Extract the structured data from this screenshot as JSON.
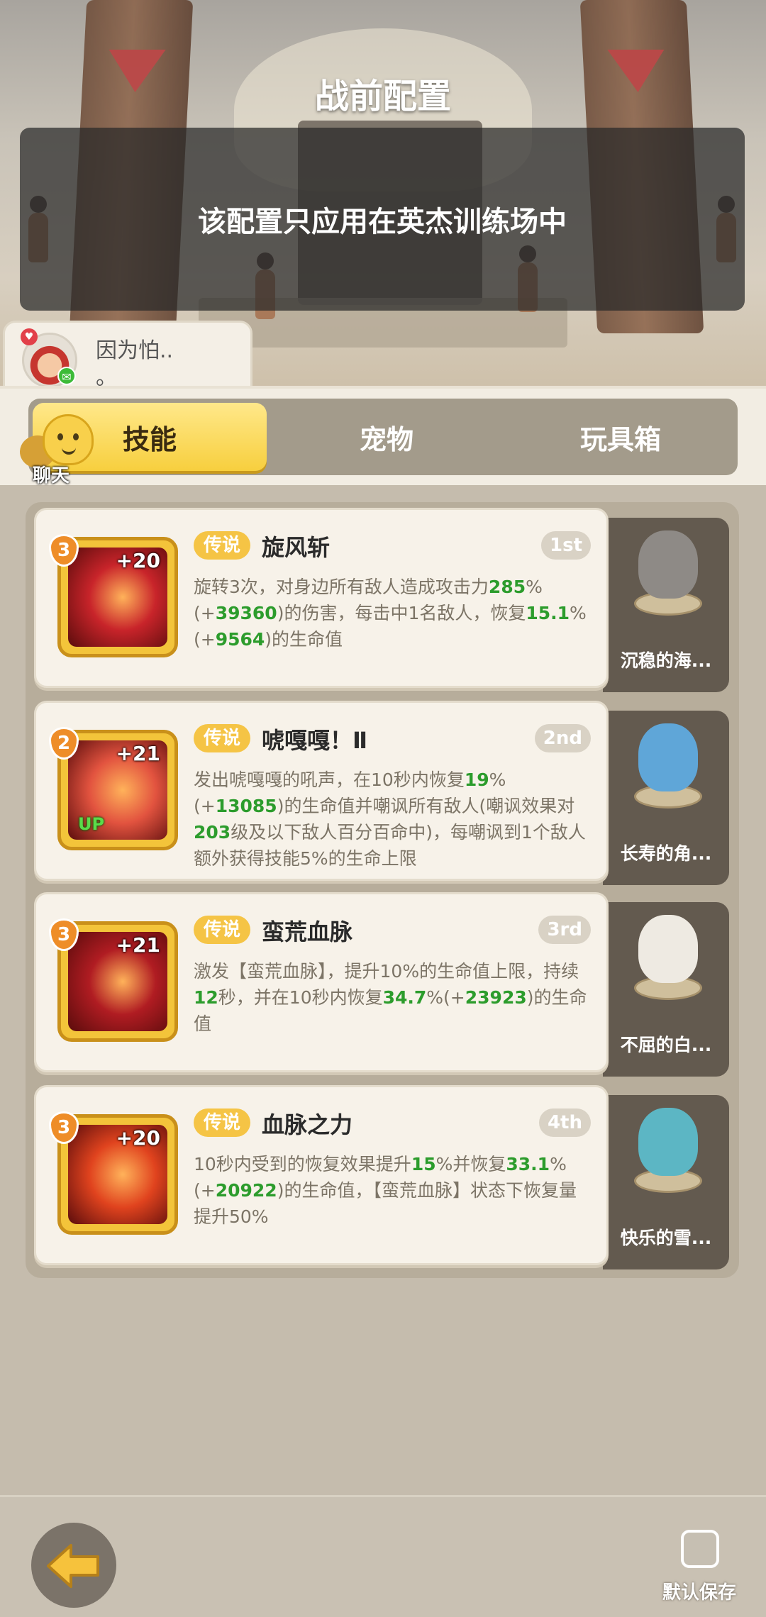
{
  "page": {
    "title": "战前配置",
    "notice": "该配置只应用在英杰训练场中"
  },
  "player": {
    "name_line1": "因为怕..",
    "name_line2": "。"
  },
  "chat": {
    "label": "聊天"
  },
  "tabs": [
    {
      "label": "技能",
      "active": true
    },
    {
      "label": "宠物",
      "active": false
    },
    {
      "label": "玩具箱",
      "active": false
    }
  ],
  "skills": [
    {
      "level": "3",
      "plus": "+20",
      "rarity": "传说",
      "name": "旋风斩",
      "rank": "1st",
      "desc_parts": [
        "旋转3次，对身边所有敌人造成攻击力",
        "285",
        "%(+",
        "39360",
        ")的伤害，每击中1名敌人，恢复",
        "15.1",
        "%(+",
        "9564",
        ")的生命值"
      ],
      "pet_name": "沉稳的海...",
      "colors": {
        "icon": "#c8242a",
        "pet": "#8e8a86"
      }
    },
    {
      "level": "2",
      "plus": "+21",
      "up": "UP",
      "rarity": "传说",
      "name": "唬嘎嘎！Ⅱ",
      "rank": "2nd",
      "desc_parts": [
        "发出唬嘎嘎的吼声，在10秒内恢复",
        "19",
        "%(+",
        "13085",
        ")的生命值并嘲讽所有敌人(嘲讽效果对",
        "203",
        "级及以下敌人百分百命中)，每嘲讽到1个敌人额外获得技能5%的生命上限",
        "",
        "",
        ""
      ],
      "pet_name": "长寿的角...",
      "colors": {
        "icon": "#e2533f",
        "pet": "#5fa6d8"
      }
    },
    {
      "level": "3",
      "plus": "+21",
      "rarity": "传说",
      "name": "蛮荒血脉",
      "rank": "3rd",
      "desc_parts": [
        "激发【蛮荒血脉】，提升10%的生命值上限，持续",
        "12",
        "秒，并在10秒内恢复",
        "34.7",
        "%(+",
        "23923",
        ")的生命值",
        "",
        "",
        ""
      ],
      "pet_name": "不屈的白...",
      "colors": {
        "icon": "#b01c22",
        "pet": "#eeeae2"
      }
    },
    {
      "level": "3",
      "plus": "+20",
      "rarity": "传说",
      "name": "血脉之力",
      "rank": "4th",
      "desc_parts": [
        "10秒内受到的恢复效果提升",
        "15",
        "%并恢复",
        "33.1",
        "%(+",
        "20922",
        ")的生命值，【蛮荒血脉】状态下恢复量提升50%",
        "",
        "",
        ""
      ],
      "pet_name": "快乐的雪...",
      "colors": {
        "icon": "#e0431e",
        "pet": "#5cb6c4"
      }
    }
  ],
  "footer": {
    "save_label": "默认保存"
  }
}
